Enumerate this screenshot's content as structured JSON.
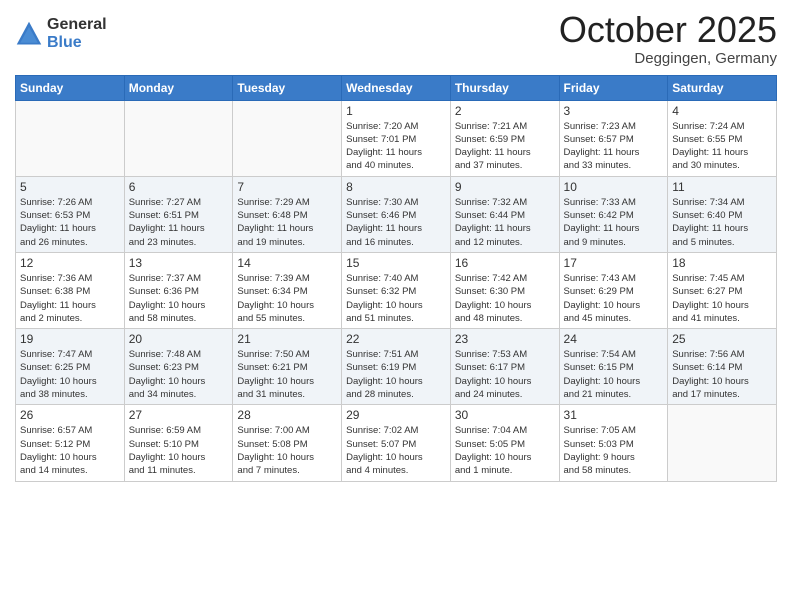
{
  "header": {
    "logo_general": "General",
    "logo_blue": "Blue",
    "month_title": "October 2025",
    "location": "Deggingen, Germany"
  },
  "weekdays": [
    "Sunday",
    "Monday",
    "Tuesday",
    "Wednesday",
    "Thursday",
    "Friday",
    "Saturday"
  ],
  "weeks": [
    [
      {
        "day": "",
        "info": ""
      },
      {
        "day": "",
        "info": ""
      },
      {
        "day": "",
        "info": ""
      },
      {
        "day": "1",
        "info": "Sunrise: 7:20 AM\nSunset: 7:01 PM\nDaylight: 11 hours\nand 40 minutes."
      },
      {
        "day": "2",
        "info": "Sunrise: 7:21 AM\nSunset: 6:59 PM\nDaylight: 11 hours\nand 37 minutes."
      },
      {
        "day": "3",
        "info": "Sunrise: 7:23 AM\nSunset: 6:57 PM\nDaylight: 11 hours\nand 33 minutes."
      },
      {
        "day": "4",
        "info": "Sunrise: 7:24 AM\nSunset: 6:55 PM\nDaylight: 11 hours\nand 30 minutes."
      }
    ],
    [
      {
        "day": "5",
        "info": "Sunrise: 7:26 AM\nSunset: 6:53 PM\nDaylight: 11 hours\nand 26 minutes."
      },
      {
        "day": "6",
        "info": "Sunrise: 7:27 AM\nSunset: 6:51 PM\nDaylight: 11 hours\nand 23 minutes."
      },
      {
        "day": "7",
        "info": "Sunrise: 7:29 AM\nSunset: 6:48 PM\nDaylight: 11 hours\nand 19 minutes."
      },
      {
        "day": "8",
        "info": "Sunrise: 7:30 AM\nSunset: 6:46 PM\nDaylight: 11 hours\nand 16 minutes."
      },
      {
        "day": "9",
        "info": "Sunrise: 7:32 AM\nSunset: 6:44 PM\nDaylight: 11 hours\nand 12 minutes."
      },
      {
        "day": "10",
        "info": "Sunrise: 7:33 AM\nSunset: 6:42 PM\nDaylight: 11 hours\nand 9 minutes."
      },
      {
        "day": "11",
        "info": "Sunrise: 7:34 AM\nSunset: 6:40 PM\nDaylight: 11 hours\nand 5 minutes."
      }
    ],
    [
      {
        "day": "12",
        "info": "Sunrise: 7:36 AM\nSunset: 6:38 PM\nDaylight: 11 hours\nand 2 minutes."
      },
      {
        "day": "13",
        "info": "Sunrise: 7:37 AM\nSunset: 6:36 PM\nDaylight: 10 hours\nand 58 minutes."
      },
      {
        "day": "14",
        "info": "Sunrise: 7:39 AM\nSunset: 6:34 PM\nDaylight: 10 hours\nand 55 minutes."
      },
      {
        "day": "15",
        "info": "Sunrise: 7:40 AM\nSunset: 6:32 PM\nDaylight: 10 hours\nand 51 minutes."
      },
      {
        "day": "16",
        "info": "Sunrise: 7:42 AM\nSunset: 6:30 PM\nDaylight: 10 hours\nand 48 minutes."
      },
      {
        "day": "17",
        "info": "Sunrise: 7:43 AM\nSunset: 6:29 PM\nDaylight: 10 hours\nand 45 minutes."
      },
      {
        "day": "18",
        "info": "Sunrise: 7:45 AM\nSunset: 6:27 PM\nDaylight: 10 hours\nand 41 minutes."
      }
    ],
    [
      {
        "day": "19",
        "info": "Sunrise: 7:47 AM\nSunset: 6:25 PM\nDaylight: 10 hours\nand 38 minutes."
      },
      {
        "day": "20",
        "info": "Sunrise: 7:48 AM\nSunset: 6:23 PM\nDaylight: 10 hours\nand 34 minutes."
      },
      {
        "day": "21",
        "info": "Sunrise: 7:50 AM\nSunset: 6:21 PM\nDaylight: 10 hours\nand 31 minutes."
      },
      {
        "day": "22",
        "info": "Sunrise: 7:51 AM\nSunset: 6:19 PM\nDaylight: 10 hours\nand 28 minutes."
      },
      {
        "day": "23",
        "info": "Sunrise: 7:53 AM\nSunset: 6:17 PM\nDaylight: 10 hours\nand 24 minutes."
      },
      {
        "day": "24",
        "info": "Sunrise: 7:54 AM\nSunset: 6:15 PM\nDaylight: 10 hours\nand 21 minutes."
      },
      {
        "day": "25",
        "info": "Sunrise: 7:56 AM\nSunset: 6:14 PM\nDaylight: 10 hours\nand 17 minutes."
      }
    ],
    [
      {
        "day": "26",
        "info": "Sunrise: 6:57 AM\nSunset: 5:12 PM\nDaylight: 10 hours\nand 14 minutes."
      },
      {
        "day": "27",
        "info": "Sunrise: 6:59 AM\nSunset: 5:10 PM\nDaylight: 10 hours\nand 11 minutes."
      },
      {
        "day": "28",
        "info": "Sunrise: 7:00 AM\nSunset: 5:08 PM\nDaylight: 10 hours\nand 7 minutes."
      },
      {
        "day": "29",
        "info": "Sunrise: 7:02 AM\nSunset: 5:07 PM\nDaylight: 10 hours\nand 4 minutes."
      },
      {
        "day": "30",
        "info": "Sunrise: 7:04 AM\nSunset: 5:05 PM\nDaylight: 10 hours\nand 1 minute."
      },
      {
        "day": "31",
        "info": "Sunrise: 7:05 AM\nSunset: 5:03 PM\nDaylight: 9 hours\nand 58 minutes."
      },
      {
        "day": "",
        "info": ""
      }
    ]
  ]
}
